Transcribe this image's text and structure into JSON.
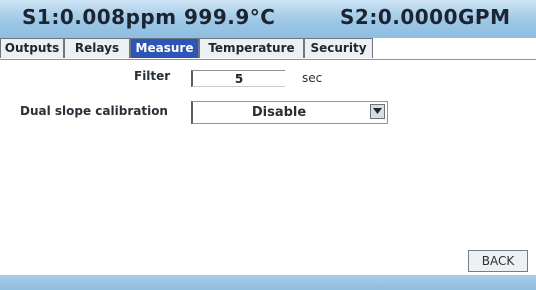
{
  "status": {
    "left": "S1:0.008ppm 999.9°C",
    "right": "S2:0.0000GPM"
  },
  "tabs": [
    {
      "label": "Outputs",
      "active": false
    },
    {
      "label": "Relays",
      "active": false
    },
    {
      "label": "Measure",
      "active": true
    },
    {
      "label": "Temperature",
      "active": false
    },
    {
      "label": "Security",
      "active": false
    }
  ],
  "measure": {
    "filter_label": "Filter",
    "filter_value": "5",
    "filter_unit": "sec",
    "dual_slope_label": "Dual slope calibration",
    "dual_slope_value": "Disable"
  },
  "footer": {
    "back_label": "BACK"
  },
  "icons": {
    "dropdown": "chevron-down-icon"
  },
  "colors": {
    "status_bar": "#9dc7e6",
    "active_tab": "#2d55b8"
  }
}
